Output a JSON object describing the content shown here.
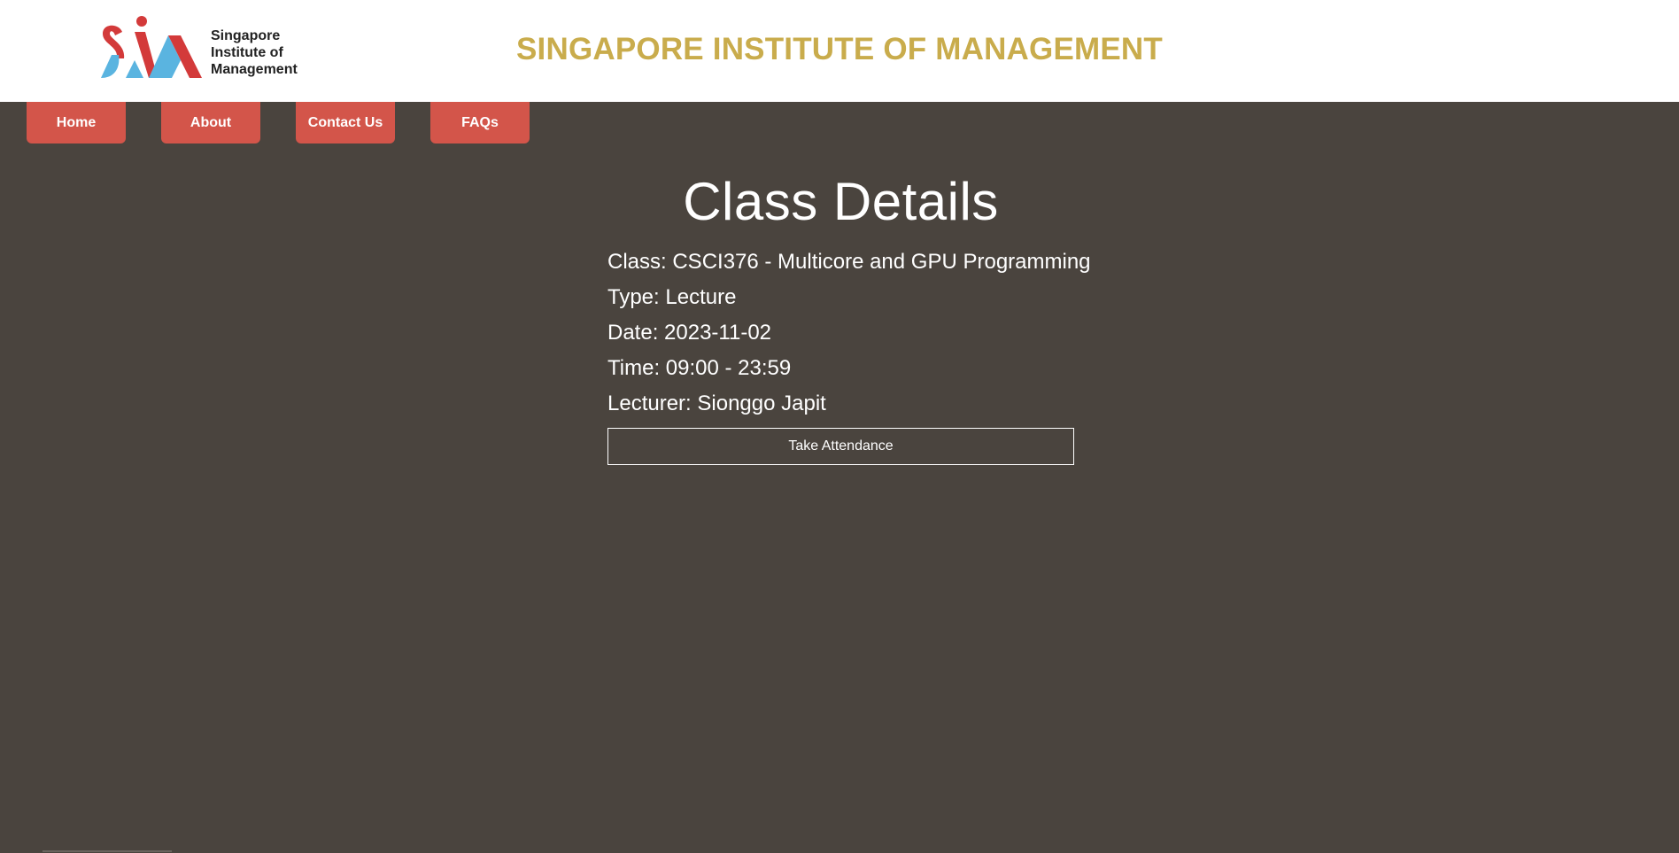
{
  "header": {
    "logo": {
      "icon": "sim-logo-mark",
      "text_lines": [
        "Singapore",
        "Institute of",
        "Management"
      ]
    },
    "site_title": "SINGAPORE INSTITUTE OF MANAGEMENT"
  },
  "nav": {
    "items": [
      {
        "label": "Home"
      },
      {
        "label": "About"
      },
      {
        "label": "Contact Us"
      },
      {
        "label": "FAQs"
      }
    ]
  },
  "main": {
    "title": "Class Details",
    "details": {
      "class": "Class: CSCI376 - Multicore and GPU Programming",
      "type": "Type: Lecture",
      "date": "Date: 2023-11-02",
      "time": "Time: 09:00 - 23:59",
      "lecturer": "Lecturer: Sionggo Japit"
    },
    "attendance_button": "Take Attendance"
  },
  "colors": {
    "background": "#4a443e",
    "header_bg": "#ffffff",
    "title_gold": "#c9ac4c",
    "nav_button": "#d3554a",
    "logo_red": "#d33a3a",
    "logo_blue": "#5ab4e0"
  }
}
